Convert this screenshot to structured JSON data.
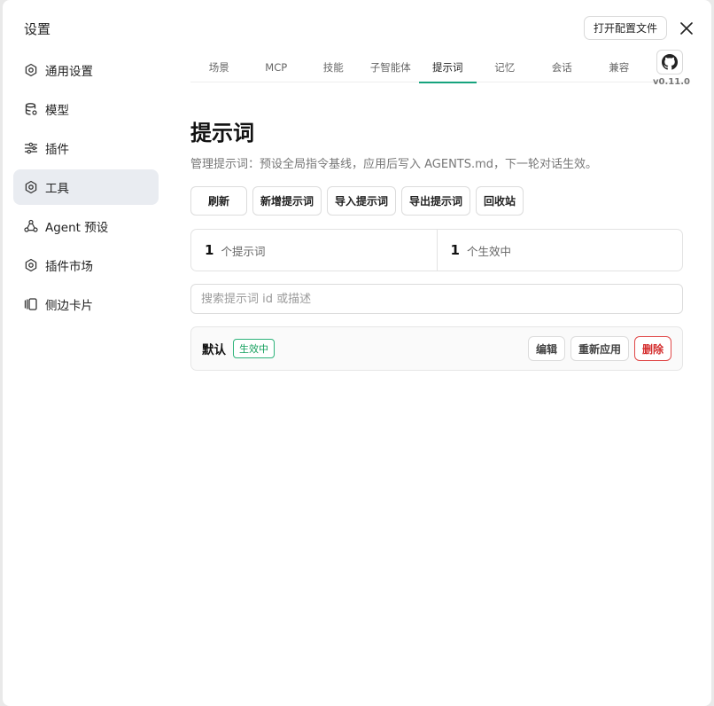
{
  "window": {
    "title": "设置",
    "open_config_label": "打开配置文件"
  },
  "sidebar": {
    "items": [
      {
        "label": "通用设置",
        "icon": "gear-icon",
        "active": false
      },
      {
        "label": "模型",
        "icon": "database-icon",
        "active": false
      },
      {
        "label": "插件",
        "icon": "sliders-icon",
        "active": false
      },
      {
        "label": "工具",
        "icon": "gear-icon",
        "active": true
      },
      {
        "label": "Agent 预设",
        "icon": "agent-icon",
        "active": false
      },
      {
        "label": "插件市场",
        "icon": "gear-icon",
        "active": false
      },
      {
        "label": "侧边卡片",
        "icon": "cards-icon",
        "active": false
      }
    ]
  },
  "tabs": [
    "场景",
    "MCP",
    "技能",
    "子智能体",
    "提示词",
    "记忆",
    "会话",
    "兼容"
  ],
  "active_tab": "提示词",
  "version": "v0.11.0",
  "main": {
    "title": "提示词",
    "description": "管理提示词：预设全局指令基线，应用后写入 AGENTS.md，下一轮对话生效。",
    "actions": [
      "刷新",
      "新增提示词",
      "导入提示词",
      "导出提示词",
      "回收站"
    ],
    "stats": [
      {
        "num": "1",
        "label": "个提示词"
      },
      {
        "num": "1",
        "label": "个生效中"
      }
    ],
    "search_placeholder": "搜索提示词 id 或描述",
    "rows": [
      {
        "name": "默认",
        "badge": "生效中",
        "edit": "编辑",
        "reapply": "重新应用",
        "delete": "删除"
      }
    ]
  },
  "colors": {
    "accent": "#16a37d",
    "danger": "#d42c2c",
    "active_bg": "#e9ecf1"
  }
}
